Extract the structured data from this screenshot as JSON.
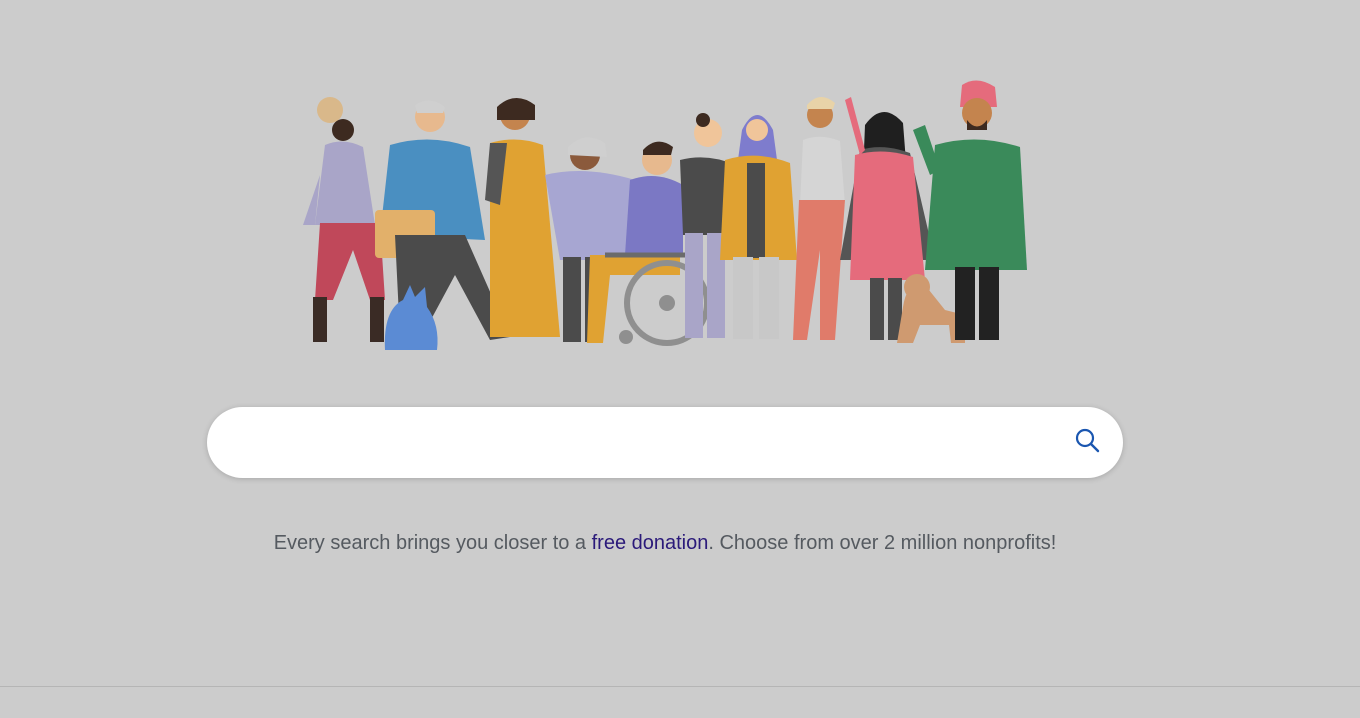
{
  "search": {
    "placeholder": "",
    "value": "",
    "icon": "search-icon",
    "accent_color": "#1a56b0"
  },
  "tagline": {
    "prefix": "Every search brings you closer to a ",
    "link_text": "free donation",
    "suffix": ". Choose from over 2 million nonprofits!",
    "link_color": "#2b1a7a"
  },
  "hero": {
    "illustration": "diverse-people-illustration"
  }
}
